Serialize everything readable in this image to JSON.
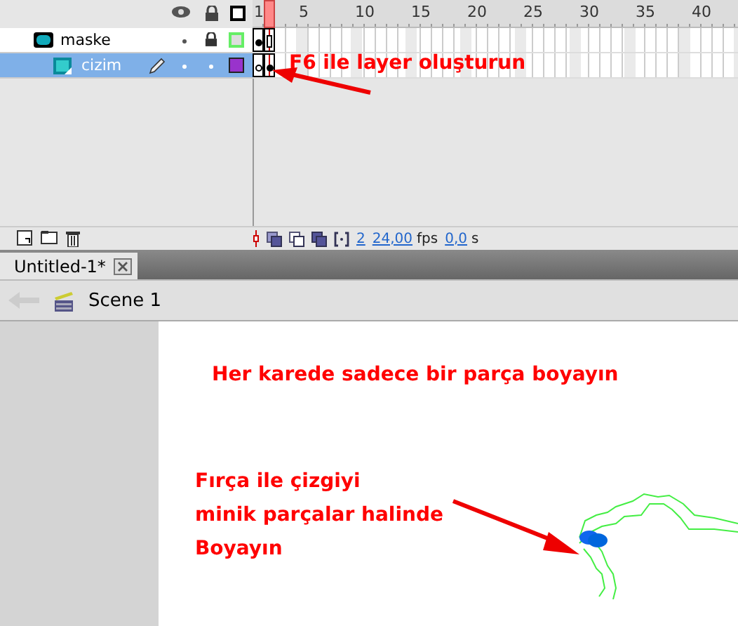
{
  "timeline": {
    "frame_numbers": [
      "1",
      "5",
      "10",
      "15",
      "20",
      "25",
      "30",
      "35",
      "40"
    ],
    "layers": [
      {
        "name": "maske",
        "kind": "mask",
        "selected": false,
        "locked": true,
        "frames": [
          {
            "kind": "keyframe",
            "selected": false
          },
          {
            "kind": "end",
            "selected": true
          }
        ]
      },
      {
        "name": "cizim",
        "kind": "masked",
        "selected": true,
        "locked": false,
        "frames": [
          {
            "kind": "empty",
            "selected": false
          },
          {
            "kind": "keyframe",
            "selected": true
          }
        ]
      }
    ],
    "toolbar": {
      "frame": "2",
      "fps": "24,00",
      "fps_unit": "fps",
      "time": "0,0",
      "time_unit": "s"
    }
  },
  "document_tab": {
    "title": "Untitled-1*",
    "selected": true
  },
  "scene": {
    "name": "Scene 1"
  },
  "annotations": {
    "timeline_note": "F6 ile layer oluşturun",
    "stage_note": "Her karede sadece bir parça boyayın",
    "brush_note": [
      "Fırça ile çizgiyi",
      "minik parçalar halinde",
      "Boyayın"
    ]
  }
}
